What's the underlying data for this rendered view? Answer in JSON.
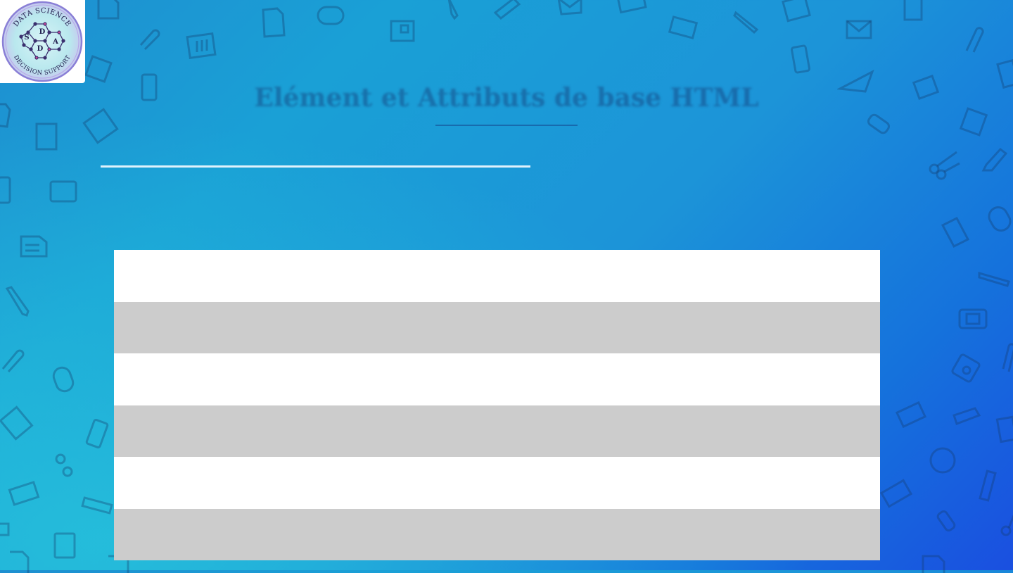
{
  "slide": {
    "title": "Elément et Attributs de base HTML"
  },
  "logo": {
    "top_text": "DATA SCIENCE",
    "bottom_text": "DECISION SUPPORT",
    "letters": [
      "S",
      "D",
      "D",
      "A"
    ]
  },
  "table": {
    "row_colors": [
      "#ffffff",
      "#cccccc",
      "#ffffff",
      "#cccccc",
      "#ffffff",
      "#cccccc"
    ],
    "rows": [
      "",
      "",
      "",
      "",
      "",
      ""
    ]
  },
  "colors": {
    "background_start": "#1e8fd0",
    "background_end": "#1a4fe0",
    "row_light": "#ffffff",
    "row_dark": "#cccccc"
  }
}
